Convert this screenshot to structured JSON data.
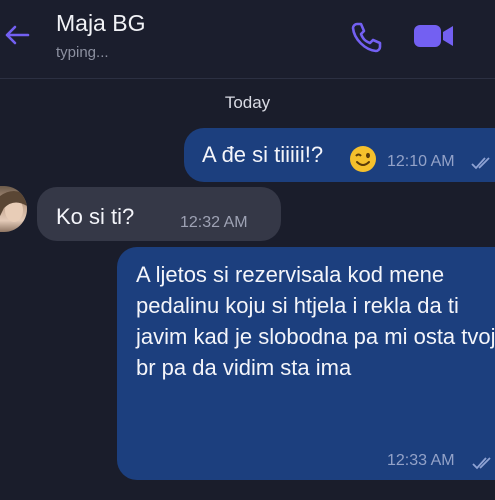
{
  "header": {
    "contact_name": "Maja BG",
    "status": "typing..."
  },
  "chat": {
    "date_separator": "Today",
    "messages": [
      {
        "direction": "outgoing",
        "text": "A đe si tiiiii!?",
        "emoji": "winking-face",
        "time": "12:10 AM",
        "read": true
      },
      {
        "direction": "incoming",
        "text": "Ko si ti?",
        "time": "12:32 AM"
      },
      {
        "direction": "outgoing",
        "text": "A ljetos si rezervisala kod mene pedalinu koju si htjela i rekla da ti javim kad je slobodna pa mi osta tvoj br pa da vidim sta ima",
        "time": "12:33 AM",
        "read": true
      }
    ]
  },
  "colors": {
    "background": "#1a1d2b",
    "outgoing_bubble": "#1c3f7e",
    "incoming_bubble": "#353847",
    "accent": "#7360f2"
  }
}
